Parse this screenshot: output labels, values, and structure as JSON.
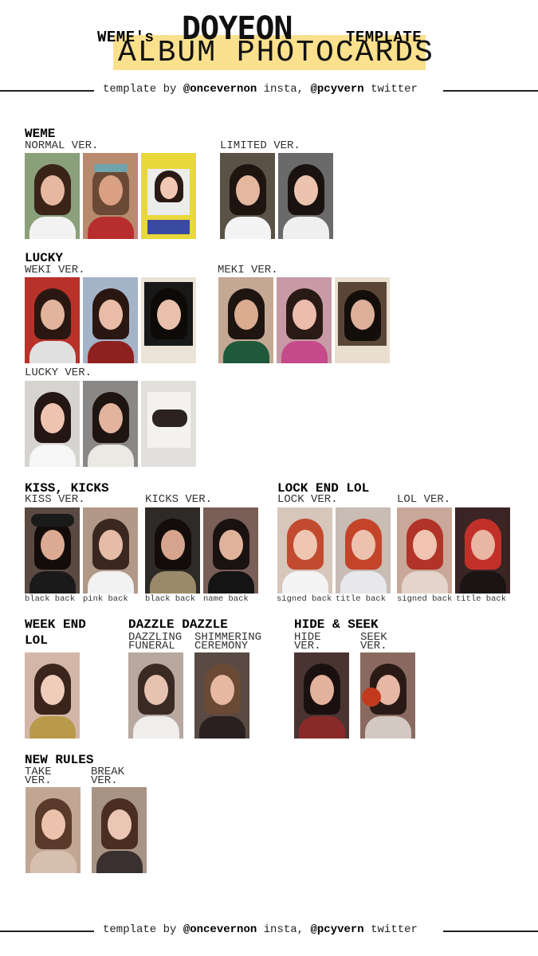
{
  "header": {
    "left_word": "WEME's",
    "name": "DOYEON",
    "right_word": "TEMPLATE",
    "subtitle": "ALBUM PHOTOCARDS",
    "credit_prefix": "template by",
    "credit_insta_handle": "@oncevernon",
    "credit_insta_label": "insta,",
    "credit_twitter_handle": "@pcyvern",
    "credit_twitter_label": "twitter",
    "highlight_color": "#fbe08d"
  },
  "sections": {
    "weme": {
      "title": "WEME",
      "normal": "NORMAL VER.",
      "limited": "LIMITED VER."
    },
    "lucky": {
      "title": "LUCKY",
      "weki": "WEKI VER.",
      "meki": "MEKI VER.",
      "lucky": "LUCKY VER."
    },
    "kiss": {
      "title": "KISS, KICKS",
      "kiss": "KISS VER.",
      "kicks": "KICKS VER.",
      "cap1": "black back",
      "cap2": "pink back",
      "cap3": "black back",
      "cap4": "name back"
    },
    "lock": {
      "title": "LOCK END LOL",
      "lock": "LOCK VER.",
      "lol": "LOL VER.",
      "cap1": "signed back",
      "cap2": "title back",
      "cap3": "signed back",
      "cap4": "title back"
    },
    "weekend": {
      "title_1": "WEEK END",
      "title_2": "LOL"
    },
    "dazzle": {
      "title": "DAZZLE DAZZLE",
      "v1_1": "DAZZLING",
      "v1_2": "FUNERAL",
      "v2_1": "SHIMMERING",
      "v2_2": "CEREMONY"
    },
    "hide": {
      "title": "HIDE & SEEK",
      "v1_1": "HIDE",
      "v1_2": "VER.",
      "v2_1": "SEEK",
      "v2_2": "VER."
    },
    "newrules": {
      "title": "NEW RULES",
      "v1_1": "TAKE",
      "v1_2": "VER.",
      "v2_1": "BREAK",
      "v2_2": "VER."
    }
  }
}
